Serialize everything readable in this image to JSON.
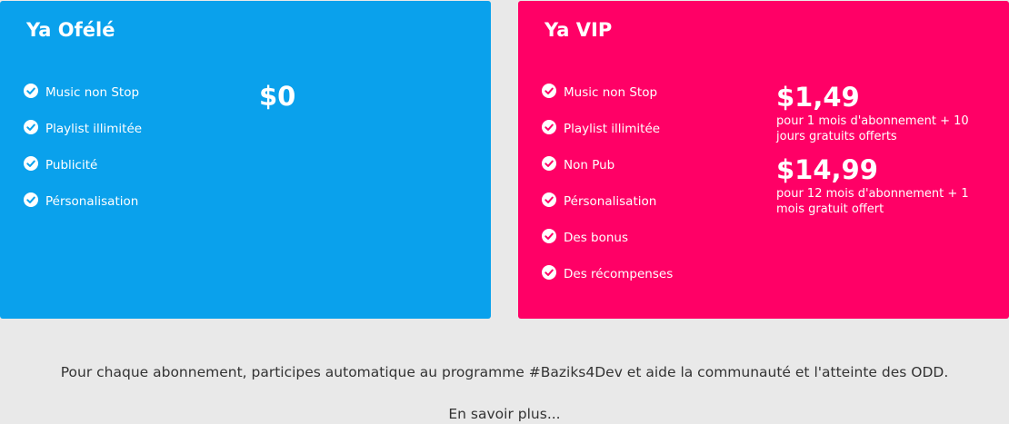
{
  "plans": {
    "free": {
      "title": "Ya Ofélé",
      "features": [
        "Music non Stop",
        "Playlist illimitée",
        "Publicité",
        "Pérsonalisation"
      ],
      "price": "$0",
      "color": "#0aa1ec"
    },
    "vip": {
      "title": "Ya VIP",
      "features": [
        "Music non Stop",
        "Playlist illimitée",
        "Non Pub",
        "Pérsonalisation",
        "Des bonus",
        "Des récompenses"
      ],
      "prices": [
        {
          "amount": "$1,49",
          "description": "pour 1 mois d'abonnement + 10 jours gratuits offerts"
        },
        {
          "amount": "$14,99",
          "description": "pour 12 mois d'abonnement + 1 mois gratuit offert"
        }
      ],
      "color": "#ff0066"
    }
  },
  "footer": {
    "info": "Pour chaque abonnement, participes automatique au programme #Baziks4Dev et aide la communauté et l'atteinte des ODD.",
    "link_label": "En savoir plus..."
  },
  "icons": {
    "feature_icon": "check-circle-icon"
  }
}
